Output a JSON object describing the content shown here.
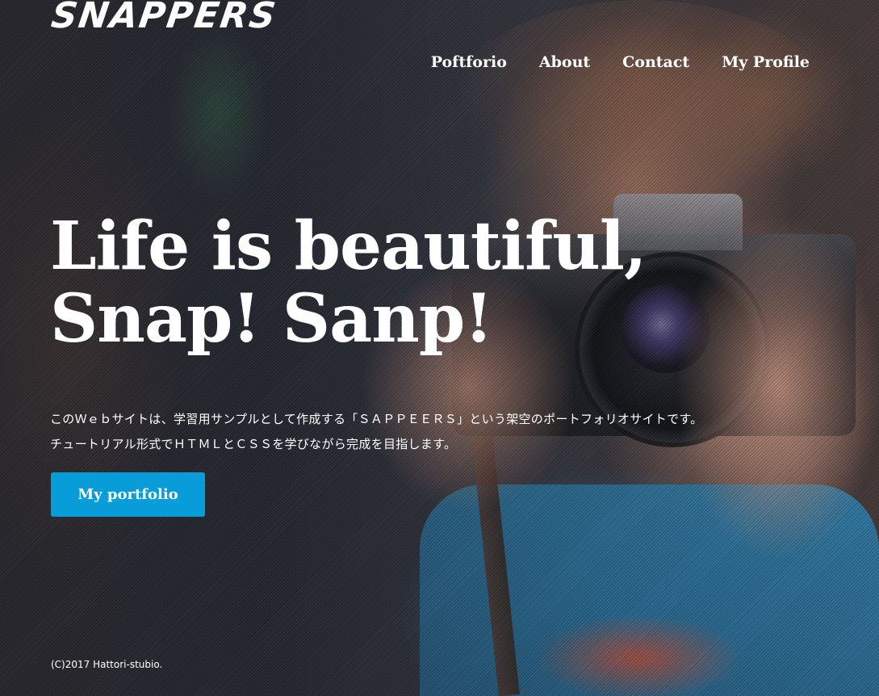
{
  "header": {
    "logo": "SNAPPERS",
    "nav": [
      "Poftforio",
      "About",
      "Contact",
      "My Profile"
    ]
  },
  "hero": {
    "headline_line1": "Life is beautiful,",
    "headline_line2": "Snap! Sanp!",
    "description_line1": "このＷｅｂサイトは、学習用サンプルとして作成する「ＳＡＰＰＥＥＲＳ」という架空のポートフォリオサイトです。",
    "description_line2": "チュートリアル形式でＨＴＭＬとＣＳＳを学びながら完成を目指します。",
    "cta_label": "My portfolio"
  },
  "footer": {
    "copyright": "(C)2017 Hattori-stubio."
  },
  "colors": {
    "accent": "#089cd8",
    "text": "#ffffff"
  }
}
